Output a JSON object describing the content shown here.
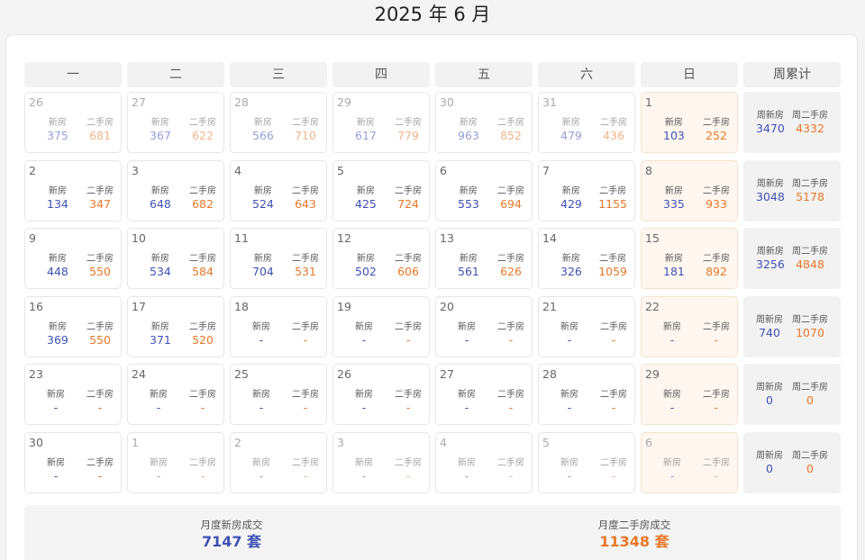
{
  "title": "2025 年 6 月",
  "labels": {
    "new": "新房",
    "old": "二手房",
    "week_new": "周新房",
    "week_old": "周二手房"
  },
  "headers": [
    "一",
    "二",
    "三",
    "四",
    "五",
    "六",
    "日",
    "周累计"
  ],
  "weeks": [
    {
      "days": [
        {
          "d": "26",
          "n": "375",
          "o": "681",
          "other": true
        },
        {
          "d": "27",
          "n": "367",
          "o": "622",
          "other": true
        },
        {
          "d": "28",
          "n": "566",
          "o": "710",
          "other": true
        },
        {
          "d": "29",
          "n": "617",
          "o": "779",
          "other": true
        },
        {
          "d": "30",
          "n": "963",
          "o": "852",
          "other": true
        },
        {
          "d": "31",
          "n": "479",
          "o": "436",
          "other": true
        },
        {
          "d": "1",
          "n": "103",
          "o": "252",
          "other": false
        }
      ],
      "total": {
        "n": "3470",
        "o": "4332"
      }
    },
    {
      "days": [
        {
          "d": "2",
          "n": "134",
          "o": "347",
          "other": false
        },
        {
          "d": "3",
          "n": "648",
          "o": "682",
          "other": false
        },
        {
          "d": "4",
          "n": "524",
          "o": "643",
          "other": false
        },
        {
          "d": "5",
          "n": "425",
          "o": "724",
          "other": false
        },
        {
          "d": "6",
          "n": "553",
          "o": "694",
          "other": false
        },
        {
          "d": "7",
          "n": "429",
          "o": "1155",
          "other": false
        },
        {
          "d": "8",
          "n": "335",
          "o": "933",
          "other": false
        }
      ],
      "total": {
        "n": "3048",
        "o": "5178"
      }
    },
    {
      "days": [
        {
          "d": "9",
          "n": "448",
          "o": "550",
          "other": false
        },
        {
          "d": "10",
          "n": "534",
          "o": "584",
          "other": false
        },
        {
          "d": "11",
          "n": "704",
          "o": "531",
          "other": false
        },
        {
          "d": "12",
          "n": "502",
          "o": "606",
          "other": false
        },
        {
          "d": "13",
          "n": "561",
          "o": "626",
          "other": false
        },
        {
          "d": "14",
          "n": "326",
          "o": "1059",
          "other": false
        },
        {
          "d": "15",
          "n": "181",
          "o": "892",
          "other": false
        }
      ],
      "total": {
        "n": "3256",
        "o": "4848"
      }
    },
    {
      "days": [
        {
          "d": "16",
          "n": "369",
          "o": "550",
          "other": false
        },
        {
          "d": "17",
          "n": "371",
          "o": "520",
          "other": false
        },
        {
          "d": "18",
          "n": "-",
          "o": "-",
          "other": false
        },
        {
          "d": "19",
          "n": "-",
          "o": "-",
          "other": false
        },
        {
          "d": "20",
          "n": "-",
          "o": "-",
          "other": false
        },
        {
          "d": "21",
          "n": "-",
          "o": "-",
          "other": false
        },
        {
          "d": "22",
          "n": "-",
          "o": "-",
          "other": false
        }
      ],
      "total": {
        "n": "740",
        "o": "1070"
      }
    },
    {
      "days": [
        {
          "d": "23",
          "n": "-",
          "o": "-",
          "other": false
        },
        {
          "d": "24",
          "n": "-",
          "o": "-",
          "other": false
        },
        {
          "d": "25",
          "n": "-",
          "o": "-",
          "other": false
        },
        {
          "d": "26",
          "n": "-",
          "o": "-",
          "other": false
        },
        {
          "d": "27",
          "n": "-",
          "o": "-",
          "other": false
        },
        {
          "d": "28",
          "n": "-",
          "o": "-",
          "other": false
        },
        {
          "d": "29",
          "n": "-",
          "o": "-",
          "other": false
        }
      ],
      "total": {
        "n": "0",
        "o": "0"
      }
    },
    {
      "days": [
        {
          "d": "30",
          "n": "-",
          "o": "-",
          "other": false
        },
        {
          "d": "1",
          "n": "-",
          "o": "-",
          "other": true
        },
        {
          "d": "2",
          "n": "-",
          "o": "-",
          "other": true
        },
        {
          "d": "3",
          "n": "-",
          "o": "-",
          "other": true
        },
        {
          "d": "4",
          "n": "-",
          "o": "-",
          "other": true
        },
        {
          "d": "5",
          "n": "-",
          "o": "-",
          "other": true
        },
        {
          "d": "6",
          "n": "-",
          "o": "-",
          "other": true
        }
      ],
      "total": {
        "n": "0",
        "o": "0"
      }
    }
  ],
  "summary": {
    "new_label": "月度新房成交",
    "new_value": "7147 套",
    "old_label": "月度二手房成交",
    "old_value": "11348 套"
  },
  "colors": {
    "new": "#3f51b5",
    "old": "#e8782a",
    "sunday_bg": "#fff7ef"
  }
}
